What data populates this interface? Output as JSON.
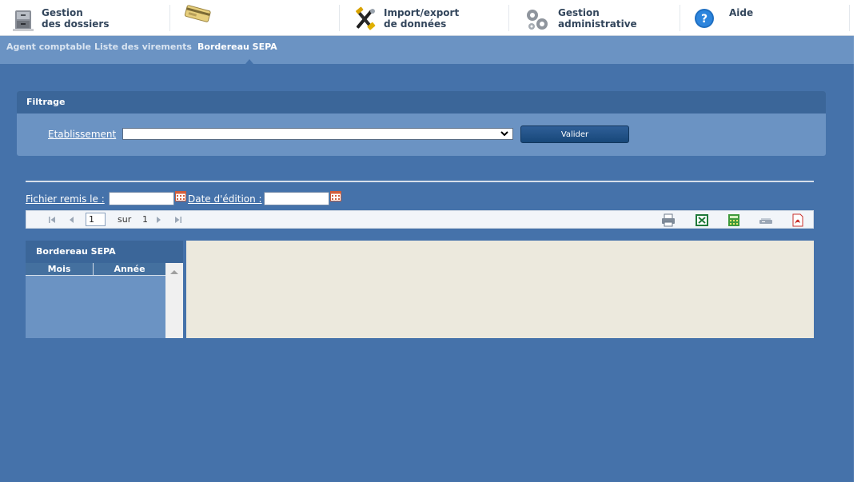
{
  "nav": {
    "items": [
      {
        "label": "Gestion\ndes dossiers",
        "icon": "cabinet-icon"
      },
      {
        "label": "",
        "icon": "payment-card-icon"
      },
      {
        "label": "Import/export\nde données",
        "icon": "tools-icon"
      },
      {
        "label": "Gestion\nadministrative",
        "icon": "gears-icon"
      },
      {
        "label": "Aide",
        "icon": "help-icon"
      }
    ]
  },
  "breadcrumb": {
    "items": [
      "Agent comptable",
      "Liste des virements",
      "Bordereau SEPA"
    ]
  },
  "filter": {
    "title": "Filtrage",
    "etablissement_label": "Etablissement",
    "etablissement_value": "",
    "validate_label": "Valider"
  },
  "dates": {
    "fichier_label": "Fichier remis le :",
    "fichier_value": "",
    "edition_label": "Date d'édition :",
    "edition_value": ""
  },
  "pager": {
    "current_page": "1",
    "of_label": "sur",
    "total_pages": "1"
  },
  "toolbar_icons": [
    "print-icon",
    "excel-icon",
    "calc-icon",
    "scanner-icon",
    "pdf-icon"
  ],
  "leftpanel": {
    "title": "Bordereau SEPA",
    "columns": [
      "Mois",
      "Année"
    ]
  },
  "colors": {
    "background": "#4572aa",
    "band": "#6b93c3",
    "panel_header": "#3b6699",
    "viewer": "#ece9dd"
  }
}
